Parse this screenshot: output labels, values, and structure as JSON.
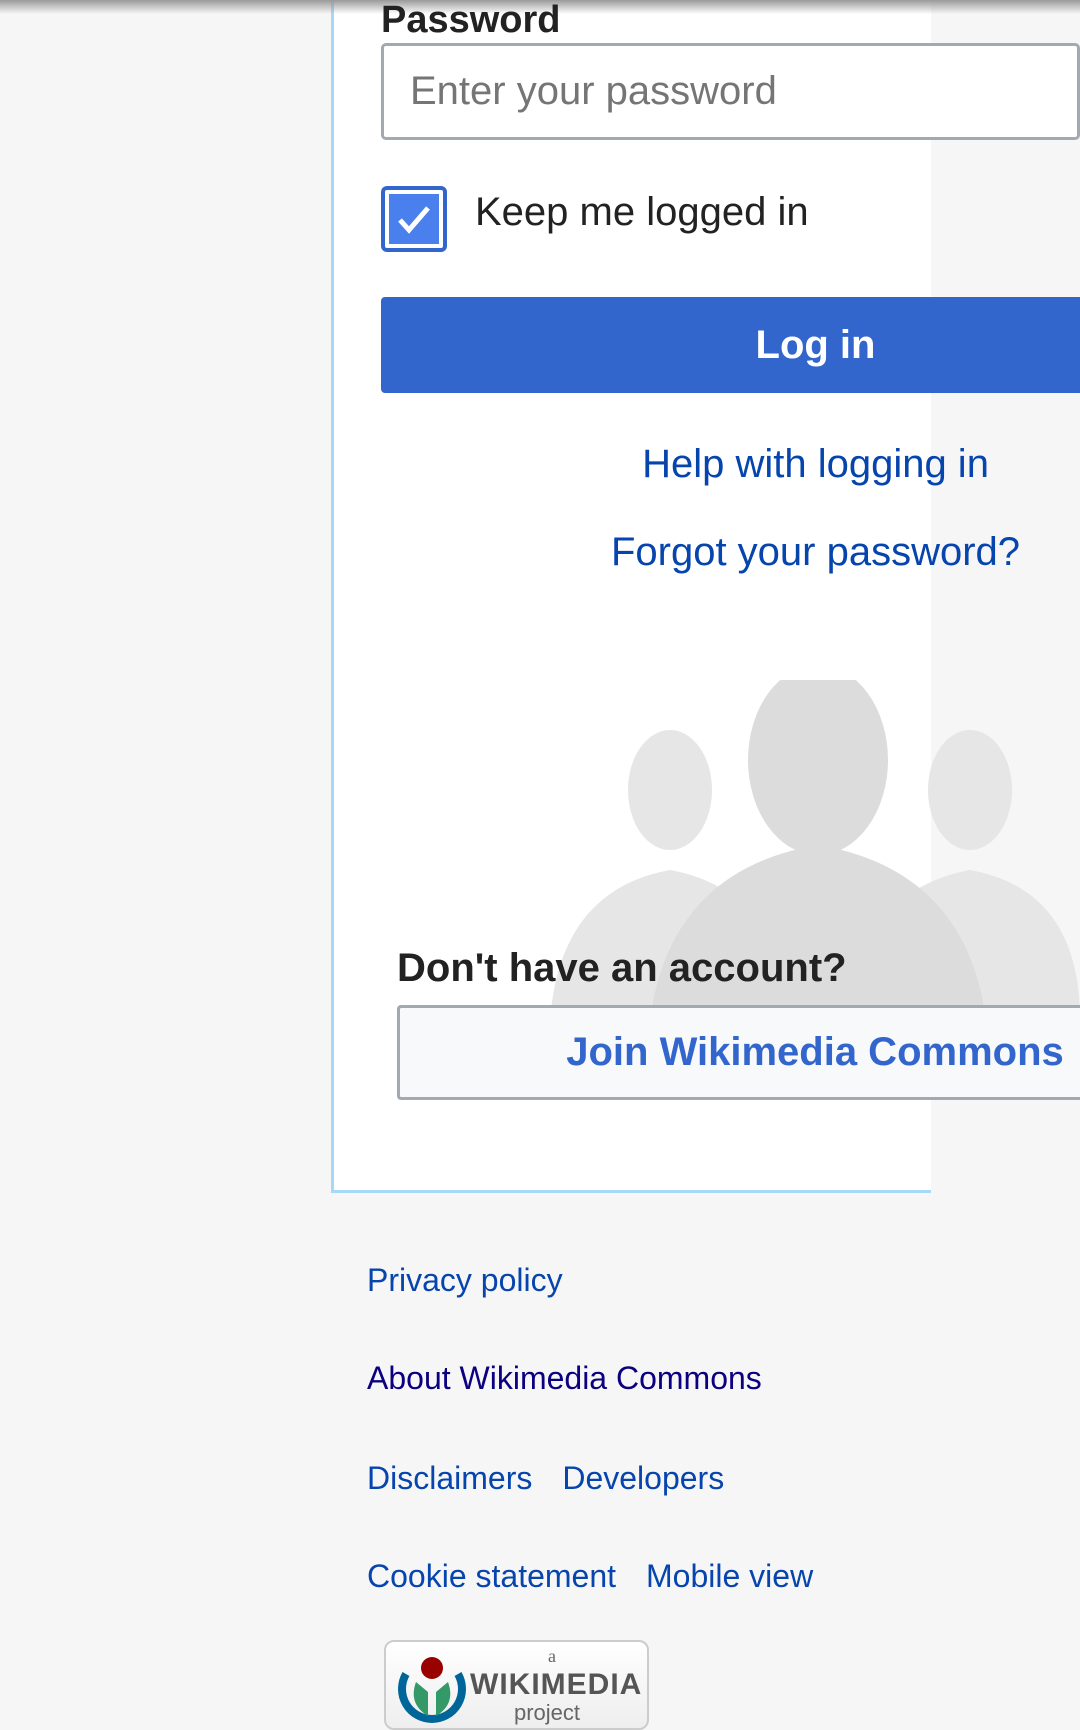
{
  "form": {
    "password_label": "Password",
    "password_placeholder": "Enter your password",
    "keep_logged_in_label": "Keep me logged in",
    "keep_logged_in_checked": true,
    "login_button": "Log in",
    "help_link": "Help with logging in",
    "forgot_link": "Forgot your password?",
    "no_account_text": "Don't have an account?",
    "join_button": "Join Wikimedia Commons"
  },
  "footer": {
    "privacy": "Privacy policy",
    "about": "About Wikimedia Commons",
    "disclaimers": "Disclaimers",
    "developers": "Developers",
    "cookie": "Cookie statement",
    "mobile": "Mobile view",
    "logo_text": "a WIKIMEDIA project"
  },
  "colors": {
    "accent": "#3366cc",
    "link": "#0645ad",
    "visited": "#0b0080"
  }
}
